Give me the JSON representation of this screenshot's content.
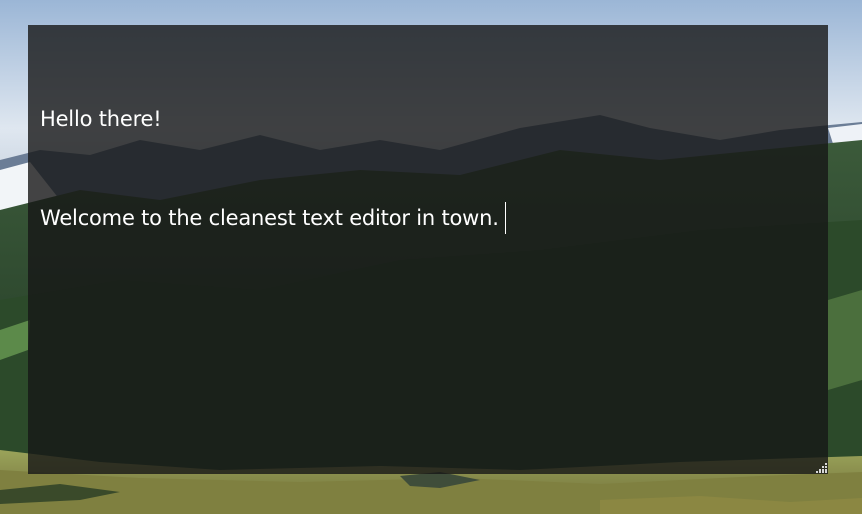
{
  "editor": {
    "lines": [
      "Hello there!",
      "Welcome to the cleanest text editor in town."
    ]
  },
  "colors": {
    "sky_top": "#a9c0db",
    "sky_bottom": "#eef2f6",
    "mountain_far": "#5a6a82",
    "mountain_near": "#24331f",
    "meadow": "#8a8f4a",
    "editor_overlay": "#161616",
    "text": "#ffffff"
  },
  "icons": {
    "resize_grip": "resize-grip-icon"
  }
}
